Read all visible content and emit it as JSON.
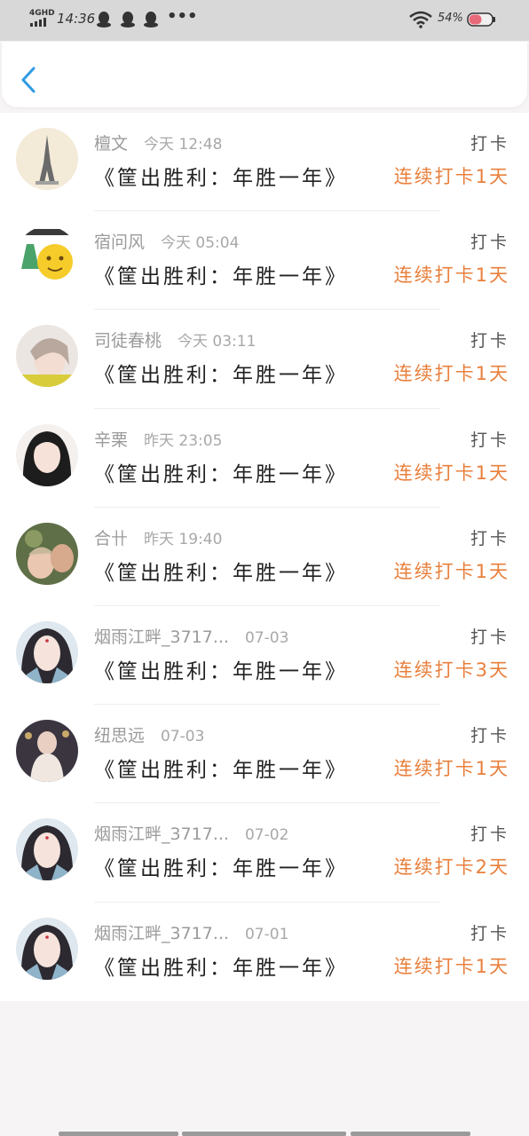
{
  "status_bar": {
    "network": "4GHD",
    "time": "14:36",
    "dots": "•••",
    "battery": "54%",
    "icons": [
      "qq-icon",
      "qq-icon",
      "qq-icon",
      "wifi-icon",
      "battery-icon"
    ]
  },
  "header": {
    "back_icon": "chevron-left-icon"
  },
  "colors": {
    "accent_blue": "#2f9be3",
    "streak_orange": "#e8803d"
  },
  "checkins": [
    {
      "name": "檀文",
      "time": "今天 12:48",
      "title": "《筐出胜利：年胜一年》",
      "label": "打卡",
      "streak": "连续打卡1天"
    },
    {
      "name": "宿问风",
      "time": "今天 05:04",
      "title": "《筐出胜利：年胜一年》",
      "label": "打卡",
      "streak": "连续打卡1天"
    },
    {
      "name": "司徒春桃",
      "time": "今天 03:11",
      "title": "《筐出胜利：年胜一年》",
      "label": "打卡",
      "streak": "连续打卡1天"
    },
    {
      "name": "辛栗",
      "time": "昨天 23:05",
      "title": "《筐出胜利：年胜一年》",
      "label": "打卡",
      "streak": "连续打卡1天"
    },
    {
      "name": "合卄",
      "time": "昨天 19:40",
      "title": "《筐出胜利：年胜一年》",
      "label": "打卡",
      "streak": "连续打卡1天"
    },
    {
      "name": "烟雨江畔_3717...",
      "time": "07-03",
      "title": "《筐出胜利：年胜一年》",
      "label": "打卡",
      "streak": "连续打卡3天"
    },
    {
      "name": "纽思远",
      "time": "07-03",
      "title": "《筐出胜利：年胜一年》",
      "label": "打卡",
      "streak": "连续打卡1天"
    },
    {
      "name": "烟雨江畔_3717...",
      "time": "07-02",
      "title": "《筐出胜利：年胜一年》",
      "label": "打卡",
      "streak": "连续打卡2天"
    },
    {
      "name": "烟雨江畔_3717...",
      "time": "07-01",
      "title": "《筐出胜利：年胜一年》",
      "label": "打卡",
      "streak": "连续打卡1天"
    }
  ]
}
